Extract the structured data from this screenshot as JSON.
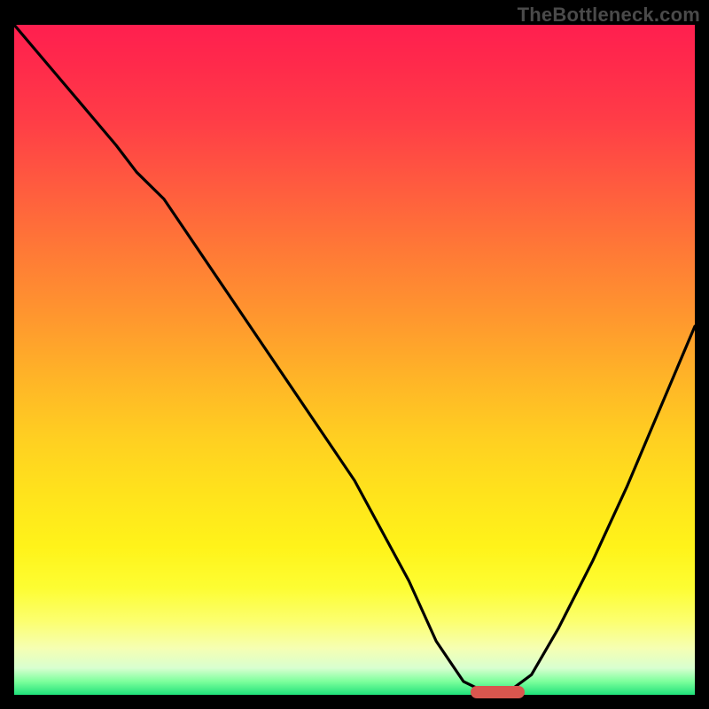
{
  "watermark": "TheBottleneck.com",
  "colors": {
    "page_bg": "#000000",
    "watermark_text": "#4a4a4a",
    "curve_stroke": "#000000",
    "pill": "#d9564e",
    "gradient_top": "#ff1f4f",
    "gradient_bottom": "#1fe17a"
  },
  "chart_data": {
    "type": "line",
    "title": "",
    "xlabel": "",
    "ylabel": "",
    "xlim": [
      0,
      100
    ],
    "ylim": [
      0,
      100
    ],
    "grid": false,
    "legend": false,
    "series": [
      {
        "name": "bottleneck-curve",
        "x": [
          0,
          5,
          10,
          15,
          18,
          22,
          30,
          40,
          50,
          58,
          62,
          66,
          70,
          72,
          76,
          80,
          85,
          90,
          95,
          100
        ],
        "y": [
          100,
          94,
          88,
          82,
          78,
          74,
          62,
          47,
          32,
          17,
          8,
          2,
          0,
          0,
          3,
          10,
          20,
          31,
          43,
          55
        ]
      }
    ],
    "optimum_marker": {
      "x": 71,
      "y": 0,
      "width_pct": 8
    },
    "annotations": []
  }
}
